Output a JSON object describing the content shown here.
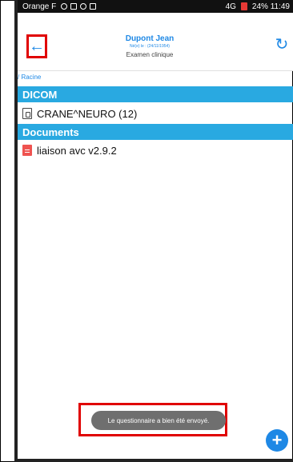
{
  "status_bar": {
    "carrier": "Orange F",
    "right": "24% 11:49",
    "signal_text": "4G"
  },
  "header": {
    "patient_name": "Dupont Jean",
    "patient_dob": "Né(e) le : (24/11/1954)",
    "exam_title": "Examen clinique",
    "back_icon": "arrow-left-icon",
    "refresh_icon": "refresh-icon"
  },
  "breadcrumb": "/ Racine",
  "sections": [
    {
      "title": "DICOM",
      "items": [
        {
          "label": "CRANE^NEURO (12)",
          "icon": "dicom-file-icon"
        }
      ]
    },
    {
      "title": "Documents",
      "items": [
        {
          "label": "liaison avc v2.9.2",
          "icon": "document-icon"
        }
      ]
    }
  ],
  "toast": {
    "message": "Le questionnaire a bien été envoyé."
  },
  "fab": {
    "icon": "plus-icon"
  },
  "colors": {
    "accent": "#1e88e5",
    "section_bg": "#29a9e1",
    "toast_bg": "#6f6f6f",
    "highlight": "#e00000"
  }
}
